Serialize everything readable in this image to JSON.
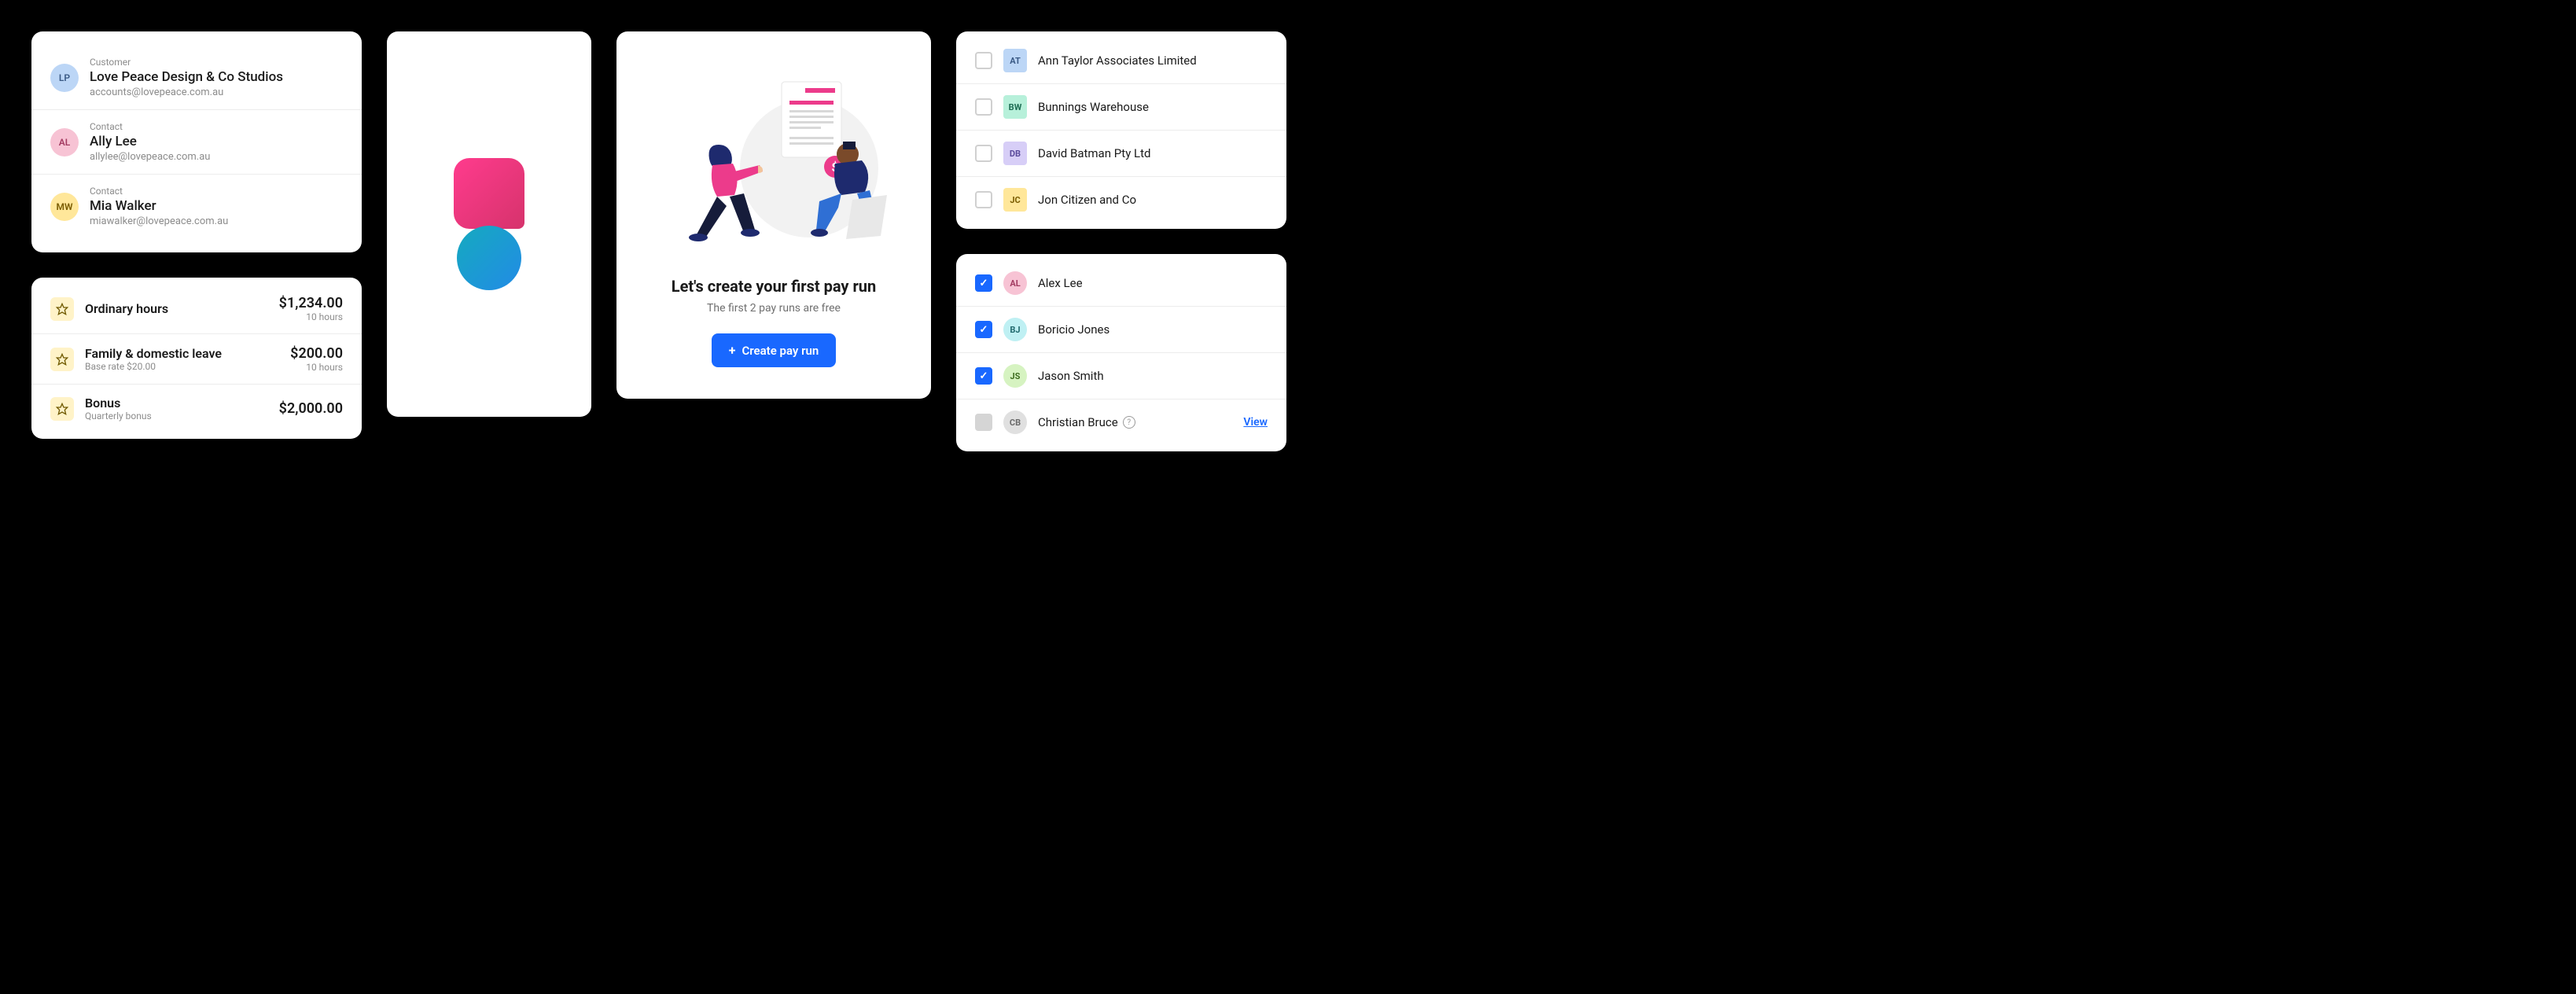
{
  "contacts": [
    {
      "label": "Customer",
      "name": "Love Peace Design & Co Studios",
      "email": "accounts@lovepeace.com.au",
      "initials": "LP",
      "bg": "#bcd6f6",
      "fg": "#3b5a85"
    },
    {
      "label": "Contact",
      "name": "Ally Lee",
      "email": "allylee@lovepeace.com.au",
      "initials": "AL",
      "bg": "#f7c3d4",
      "fg": "#a33b61"
    },
    {
      "label": "Contact",
      "name": "Mia Walker",
      "email": "miawalker@lovepeace.com.au",
      "initials": "MW",
      "bg": "#ffe79a",
      "fg": "#7a5c00"
    }
  ],
  "payitems": [
    {
      "title": "Ordinary hours",
      "sub": "",
      "amount": "$1,234.00",
      "amount_sub": "10 hours"
    },
    {
      "title": "Family & domestic leave",
      "sub": "Base rate $20.00",
      "amount": "$200.00",
      "amount_sub": "10 hours"
    },
    {
      "title": "Bonus",
      "sub": "Quarterly bonus",
      "amount": "$2,000.00",
      "amount_sub": ""
    }
  ],
  "onboard": {
    "heading": "Let's create your first pay run",
    "sub": "The first 2 pay runs are free",
    "button": "Create pay run"
  },
  "companies": [
    {
      "initials": "AT",
      "name": "Ann Taylor Associates Limited",
      "bg": "#bcd6f6",
      "fg": "#3b5a85",
      "checked": false
    },
    {
      "initials": "BW",
      "name": "Bunnings Warehouse",
      "bg": "#b7f0da",
      "fg": "#1e6e54",
      "checked": false
    },
    {
      "initials": "DB",
      "name": "David Batman Pty Ltd",
      "bg": "#d7cef7",
      "fg": "#5a4a9c",
      "checked": false
    },
    {
      "initials": "JC",
      "name": "Jon Citizen and Co",
      "bg": "#ffe79a",
      "fg": "#7a5c00",
      "checked": false
    }
  ],
  "people": [
    {
      "initials": "AL",
      "name": "Alex Lee",
      "bg": "#f7c3d4",
      "fg": "#a33b61",
      "checked": true,
      "info": false,
      "view": false
    },
    {
      "initials": "BJ",
      "name": "Boricio Jones",
      "bg": "#bff0f3",
      "fg": "#216a6e",
      "checked": true,
      "info": false,
      "view": false
    },
    {
      "initials": "JS",
      "name": "Jason Smith",
      "bg": "#d6f3c1",
      "fg": "#3e6e1f",
      "checked": true,
      "info": false,
      "view": false
    },
    {
      "initials": "CB",
      "name": "Christian Bruce",
      "bg": "#e0e0e0",
      "fg": "#6a6a6a",
      "checked": false,
      "info": true,
      "view": true
    }
  ],
  "view_label": "View"
}
